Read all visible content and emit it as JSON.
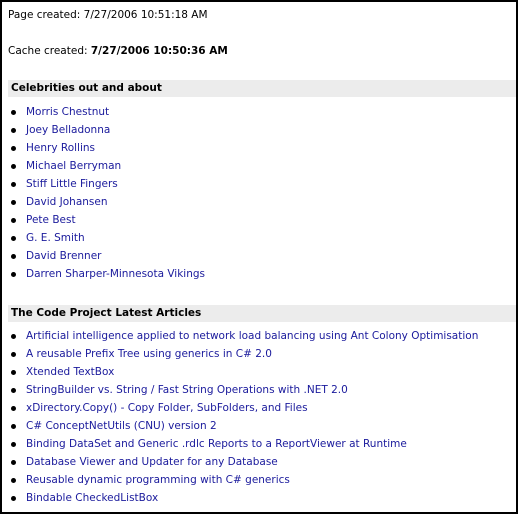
{
  "page_created": {
    "label": "Page created:",
    "value": "7/27/2006 10:51:18 AM"
  },
  "cache_created": {
    "label": "Cache created:",
    "value": "7/27/2006 10:50:36 AM"
  },
  "sections": [
    {
      "title": "Celebrities out and about",
      "items": [
        "Morris Chestnut",
        "Joey Belladonna",
        "Henry Rollins",
        "Michael Berryman",
        "Stiff Little Fingers",
        "David Johansen",
        "Pete Best",
        "G. E. Smith",
        "David Brenner",
        "Darren Sharper-Minnesota Vikings"
      ]
    },
    {
      "title": "The Code Project Latest Articles",
      "items": [
        "Artificial intelligence applied to network load balancing using Ant Colony Optimisation",
        "A reusable Prefix Tree using generics in C# 2.0",
        "Xtended TextBox",
        "StringBuilder vs. String / Fast String Operations with .NET 2.0",
        "xDirectory.Copy() - Copy Folder, SubFolders, and Files",
        "C# ConceptNetUtils (CNU) version 2",
        "Binding DataSet and Generic .rdlc Reports to a ReportViewer at Runtime",
        "Database Viewer and Updater for any Database",
        "Reusable dynamic programming with C# generics",
        "Bindable CheckedListBox"
      ]
    }
  ],
  "colors": {
    "link": "#1a1a9c",
    "section_header_bg": "#ececec",
    "border": "#000000"
  }
}
